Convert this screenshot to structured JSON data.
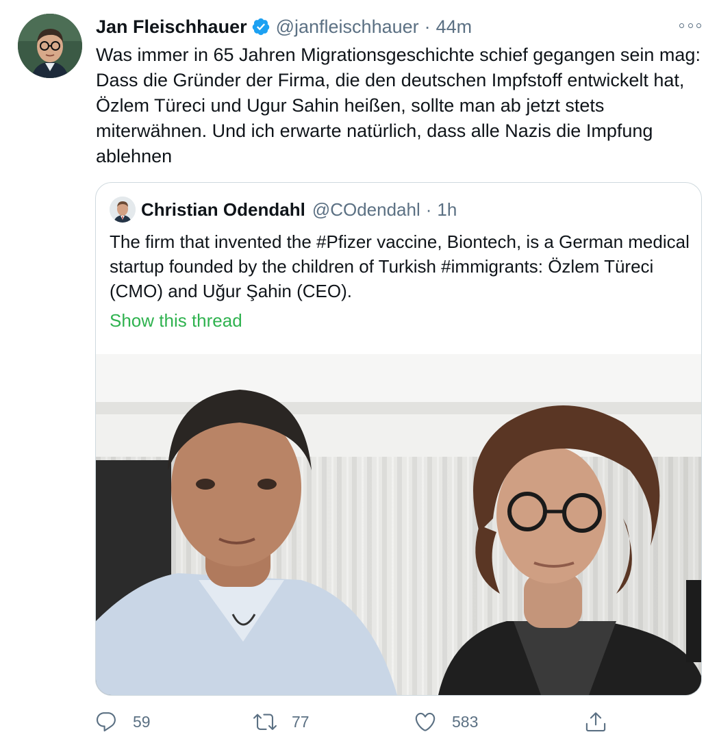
{
  "tweet": {
    "author_name": "Jan Fleischhauer",
    "handle": "@janfleischhauer",
    "separator": "·",
    "time": "44m",
    "text": "Was immer in 65 Jahren Migrationsgeschichte schief gegangen sein mag: Dass die Gründer der Firma, die den deutschen Impfstoff entwickelt hat, Özlem Türeci und Ugur Sahin heißen, sollte man ab jetzt stets miterwähnen. Und ich erwarte natürlich, dass alle Nazis die Impfung ablehnen",
    "verified": true
  },
  "quoted_tweet": {
    "author_name": "Christian Odendahl",
    "handle": "@COdendahl",
    "separator": "·",
    "time": "1h",
    "text": "The firm that invented the #Pfizer vaccine, Biontech, is a German medical startup founded by the children of Turkish #immigrants: Özlem Türeci (CMO) and Uğur Şahin (CEO).",
    "show_thread_label": "Show this thread"
  },
  "actions": {
    "reply_count": "59",
    "retweet_count": "77",
    "like_count": "583"
  },
  "icons": {
    "verified": "verified-badge-icon",
    "more": "more-options-icon",
    "reply": "reply-icon",
    "retweet": "retweet-icon",
    "like": "like-icon",
    "share": "share-icon"
  },
  "colors": {
    "verified_blue": "#1da1f2",
    "secondary_text": "#5b7083",
    "show_thread": "#2fb24f",
    "border": "#cfd9de"
  }
}
